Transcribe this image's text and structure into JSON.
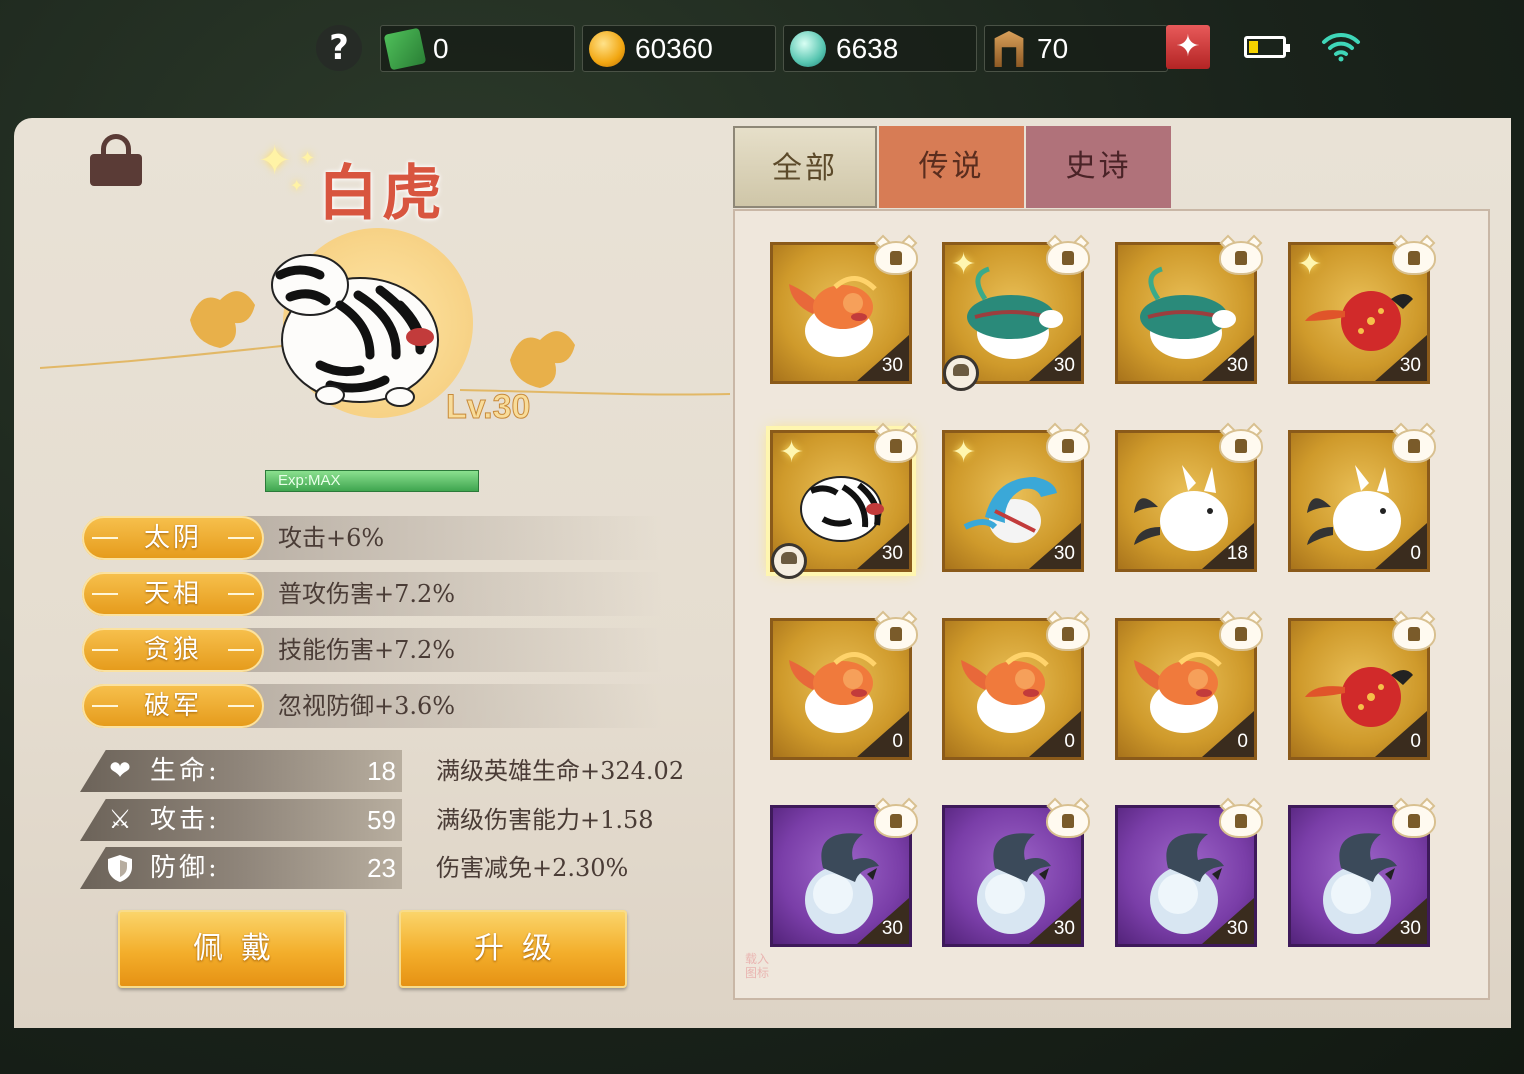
{
  "topbar": {
    "help_label": "?",
    "resources": [
      {
        "icon": "ticket-icon",
        "value": "0"
      },
      {
        "icon": "gold-ingot-icon",
        "value": "60360"
      },
      {
        "icon": "jade-icon",
        "value": "6638"
      },
      {
        "icon": "gate-icon",
        "value": "70"
      }
    ],
    "battery_level": 0.25
  },
  "hero": {
    "name": "白虎",
    "level": "Lv.30",
    "exp": "Exp:MAX",
    "attributes": [
      {
        "name": "太阴",
        "desc": "攻击+6%"
      },
      {
        "name": "天相",
        "desc": "普攻伤害+7.2%"
      },
      {
        "name": "贪狼",
        "desc": "技能伤害+7.2%"
      },
      {
        "name": "破军",
        "desc": "忽视防御+3.6%"
      }
    ],
    "stats": [
      {
        "icon": "heart-icon",
        "label": "生命:",
        "value": "18",
        "bonus": "满级英雄生命+324.02"
      },
      {
        "icon": "swords-icon",
        "label": "攻击:",
        "value": "59",
        "bonus": "满级伤害能力+1.58"
      },
      {
        "icon": "shield-icon",
        "label": "防御:",
        "value": "23",
        "bonus": "伤害减免+2.30%"
      }
    ],
    "buttons": {
      "equip": "佩戴",
      "upgrade": "升级"
    }
  },
  "tabs": [
    {
      "label": "全部",
      "active": true
    },
    {
      "label": "传说",
      "active": false
    },
    {
      "label": "史诗",
      "active": false
    }
  ],
  "watermark": "载入 图标",
  "pets": [
    {
      "kind": "fox",
      "level": "30",
      "rarity": "gold",
      "sparkle": false,
      "equipped": false,
      "selected": false
    },
    {
      "kind": "turtle",
      "level": "30",
      "rarity": "gold",
      "sparkle": true,
      "equipped": true,
      "selected": false
    },
    {
      "kind": "turtle",
      "level": "30",
      "rarity": "gold",
      "sparkle": false,
      "equipped": false,
      "selected": false
    },
    {
      "kind": "bird",
      "level": "30",
      "rarity": "gold",
      "sparkle": true,
      "equipped": false,
      "selected": false
    },
    {
      "kind": "tiger",
      "level": "30",
      "rarity": "gold",
      "sparkle": true,
      "equipped": true,
      "selected": true
    },
    {
      "kind": "dragon",
      "level": "30",
      "rarity": "gold",
      "sparkle": true,
      "equipped": false,
      "selected": false
    },
    {
      "kind": "rabbit",
      "level": "18",
      "rarity": "gold",
      "sparkle": false,
      "equipped": false,
      "selected": false
    },
    {
      "kind": "rabbit",
      "level": "0",
      "rarity": "gold",
      "sparkle": false,
      "equipped": false,
      "selected": false
    },
    {
      "kind": "fox",
      "level": "0",
      "rarity": "gold",
      "sparkle": false,
      "equipped": false,
      "selected": false
    },
    {
      "kind": "fox",
      "level": "0",
      "rarity": "gold",
      "sparkle": false,
      "equipped": false,
      "selected": false
    },
    {
      "kind": "fox",
      "level": "0",
      "rarity": "gold",
      "sparkle": false,
      "equipped": false,
      "selected": false
    },
    {
      "kind": "bird",
      "level": "0",
      "rarity": "gold",
      "sparkle": false,
      "equipped": false,
      "selected": false
    },
    {
      "kind": "bat",
      "level": "30",
      "rarity": "purple",
      "sparkle": false,
      "equipped": false,
      "selected": false
    },
    {
      "kind": "bat",
      "level": "30",
      "rarity": "purple",
      "sparkle": false,
      "equipped": false,
      "selected": false
    },
    {
      "kind": "bat",
      "level": "30",
      "rarity": "purple",
      "sparkle": false,
      "equipped": false,
      "selected": false
    },
    {
      "kind": "bat",
      "level": "30",
      "rarity": "purple",
      "sparkle": false,
      "equipped": false,
      "selected": false
    }
  ]
}
